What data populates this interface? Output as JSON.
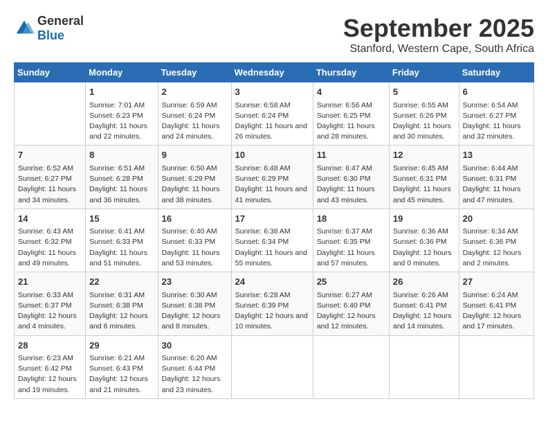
{
  "logo": {
    "general": "General",
    "blue": "Blue"
  },
  "title": "September 2025",
  "subtitle": "Stanford, Western Cape, South Africa",
  "days_header": [
    "Sunday",
    "Monday",
    "Tuesday",
    "Wednesday",
    "Thursday",
    "Friday",
    "Saturday"
  ],
  "weeks": [
    [
      {
        "day": "",
        "sunrise": "",
        "sunset": "",
        "daylight": ""
      },
      {
        "day": "1",
        "sunrise": "Sunrise: 7:01 AM",
        "sunset": "Sunset: 6:23 PM",
        "daylight": "Daylight: 11 hours and 22 minutes."
      },
      {
        "day": "2",
        "sunrise": "Sunrise: 6:59 AM",
        "sunset": "Sunset: 6:24 PM",
        "daylight": "Daylight: 11 hours and 24 minutes."
      },
      {
        "day": "3",
        "sunrise": "Sunrise: 6:58 AM",
        "sunset": "Sunset: 6:24 PM",
        "daylight": "Daylight: 11 hours and 26 minutes."
      },
      {
        "day": "4",
        "sunrise": "Sunrise: 6:56 AM",
        "sunset": "Sunset: 6:25 PM",
        "daylight": "Daylight: 11 hours and 28 minutes."
      },
      {
        "day": "5",
        "sunrise": "Sunrise: 6:55 AM",
        "sunset": "Sunset: 6:26 PM",
        "daylight": "Daylight: 11 hours and 30 minutes."
      },
      {
        "day": "6",
        "sunrise": "Sunrise: 6:54 AM",
        "sunset": "Sunset: 6:27 PM",
        "daylight": "Daylight: 11 hours and 32 minutes."
      }
    ],
    [
      {
        "day": "7",
        "sunrise": "Sunrise: 6:52 AM",
        "sunset": "Sunset: 6:27 PM",
        "daylight": "Daylight: 11 hours and 34 minutes."
      },
      {
        "day": "8",
        "sunrise": "Sunrise: 6:51 AM",
        "sunset": "Sunset: 6:28 PM",
        "daylight": "Daylight: 11 hours and 36 minutes."
      },
      {
        "day": "9",
        "sunrise": "Sunrise: 6:50 AM",
        "sunset": "Sunset: 6:29 PM",
        "daylight": "Daylight: 11 hours and 38 minutes."
      },
      {
        "day": "10",
        "sunrise": "Sunrise: 6:48 AM",
        "sunset": "Sunset: 6:29 PM",
        "daylight": "Daylight: 11 hours and 41 minutes."
      },
      {
        "day": "11",
        "sunrise": "Sunrise: 6:47 AM",
        "sunset": "Sunset: 6:30 PM",
        "daylight": "Daylight: 11 hours and 43 minutes."
      },
      {
        "day": "12",
        "sunrise": "Sunrise: 6:45 AM",
        "sunset": "Sunset: 6:31 PM",
        "daylight": "Daylight: 11 hours and 45 minutes."
      },
      {
        "day": "13",
        "sunrise": "Sunrise: 6:44 AM",
        "sunset": "Sunset: 6:31 PM",
        "daylight": "Daylight: 11 hours and 47 minutes."
      }
    ],
    [
      {
        "day": "14",
        "sunrise": "Sunrise: 6:43 AM",
        "sunset": "Sunset: 6:32 PM",
        "daylight": "Daylight: 11 hours and 49 minutes."
      },
      {
        "day": "15",
        "sunrise": "Sunrise: 6:41 AM",
        "sunset": "Sunset: 6:33 PM",
        "daylight": "Daylight: 11 hours and 51 minutes."
      },
      {
        "day": "16",
        "sunrise": "Sunrise: 6:40 AM",
        "sunset": "Sunset: 6:33 PM",
        "daylight": "Daylight: 11 hours and 53 minutes."
      },
      {
        "day": "17",
        "sunrise": "Sunrise: 6:38 AM",
        "sunset": "Sunset: 6:34 PM",
        "daylight": "Daylight: 11 hours and 55 minutes."
      },
      {
        "day": "18",
        "sunrise": "Sunrise: 6:37 AM",
        "sunset": "Sunset: 6:35 PM",
        "daylight": "Daylight: 11 hours and 57 minutes."
      },
      {
        "day": "19",
        "sunrise": "Sunrise: 6:36 AM",
        "sunset": "Sunset: 6:36 PM",
        "daylight": "Daylight: 12 hours and 0 minutes."
      },
      {
        "day": "20",
        "sunrise": "Sunrise: 6:34 AM",
        "sunset": "Sunset: 6:36 PM",
        "daylight": "Daylight: 12 hours and 2 minutes."
      }
    ],
    [
      {
        "day": "21",
        "sunrise": "Sunrise: 6:33 AM",
        "sunset": "Sunset: 6:37 PM",
        "daylight": "Daylight: 12 hours and 4 minutes."
      },
      {
        "day": "22",
        "sunrise": "Sunrise: 6:31 AM",
        "sunset": "Sunset: 6:38 PM",
        "daylight": "Daylight: 12 hours and 6 minutes."
      },
      {
        "day": "23",
        "sunrise": "Sunrise: 6:30 AM",
        "sunset": "Sunset: 6:38 PM",
        "daylight": "Daylight: 12 hours and 8 minutes."
      },
      {
        "day": "24",
        "sunrise": "Sunrise: 6:28 AM",
        "sunset": "Sunset: 6:39 PM",
        "daylight": "Daylight: 12 hours and 10 minutes."
      },
      {
        "day": "25",
        "sunrise": "Sunrise: 6:27 AM",
        "sunset": "Sunset: 6:40 PM",
        "daylight": "Daylight: 12 hours and 12 minutes."
      },
      {
        "day": "26",
        "sunrise": "Sunrise: 6:26 AM",
        "sunset": "Sunset: 6:41 PM",
        "daylight": "Daylight: 12 hours and 14 minutes."
      },
      {
        "day": "27",
        "sunrise": "Sunrise: 6:24 AM",
        "sunset": "Sunset: 6:41 PM",
        "daylight": "Daylight: 12 hours and 17 minutes."
      }
    ],
    [
      {
        "day": "28",
        "sunrise": "Sunrise: 6:23 AM",
        "sunset": "Sunset: 6:42 PM",
        "daylight": "Daylight: 12 hours and 19 minutes."
      },
      {
        "day": "29",
        "sunrise": "Sunrise: 6:21 AM",
        "sunset": "Sunset: 6:43 PM",
        "daylight": "Daylight: 12 hours and 21 minutes."
      },
      {
        "day": "30",
        "sunrise": "Sunrise: 6:20 AM",
        "sunset": "Sunset: 6:44 PM",
        "daylight": "Daylight: 12 hours and 23 minutes."
      },
      {
        "day": "",
        "sunrise": "",
        "sunset": "",
        "daylight": ""
      },
      {
        "day": "",
        "sunrise": "",
        "sunset": "",
        "daylight": ""
      },
      {
        "day": "",
        "sunrise": "",
        "sunset": "",
        "daylight": ""
      },
      {
        "day": "",
        "sunrise": "",
        "sunset": "",
        "daylight": ""
      }
    ]
  ]
}
